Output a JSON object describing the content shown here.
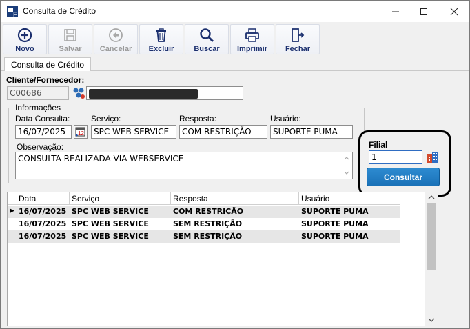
{
  "window": {
    "title": "Consulta de Crédito"
  },
  "toolbar": {
    "novo": "Novo",
    "salvar": "Salvar",
    "cancelar": "Cancelar",
    "excluir": "Excluir",
    "buscar": "Buscar",
    "imprimir": "Imprimir",
    "fechar": "Fechar"
  },
  "tabs": {
    "active": "Consulta de Crédito"
  },
  "form": {
    "cliente_label": "Cliente/Fornecedor:",
    "cliente_code": "C00686",
    "group_title": "Informações",
    "data_label": "Data Consulta:",
    "data_value": "16/07/2025",
    "servico_label": "Serviço:",
    "servico_value": "SPC WEB SERVICE",
    "resposta_label": "Resposta:",
    "resposta_value": "COM RESTRIÇÃO",
    "usuario_label": "Usuário:",
    "usuario_value": "SUPORTE PUMA",
    "obs_label": "Observação:",
    "obs_value": "CONSULTA REALIZADA VIA WEBSERVICE"
  },
  "filial": {
    "label": "Filial",
    "value": "1",
    "button": "Consultar"
  },
  "grid": {
    "headers": [
      "Data",
      "Serviço",
      "Resposta",
      "Usuário"
    ],
    "rows": [
      [
        "16/07/2025",
        "SPC WEB SERVICE",
        "COM RESTRIÇÃO",
        "SUPORTE PUMA"
      ],
      [
        "16/07/2025",
        "SPC WEB SERVICE",
        "SEM RESTRIÇÃO",
        "SUPORTE PUMA"
      ],
      [
        "16/07/2025",
        "SPC WEB SERVICE",
        "SEM RESTRIÇÃO",
        "SUPORTE PUMA"
      ]
    ]
  }
}
